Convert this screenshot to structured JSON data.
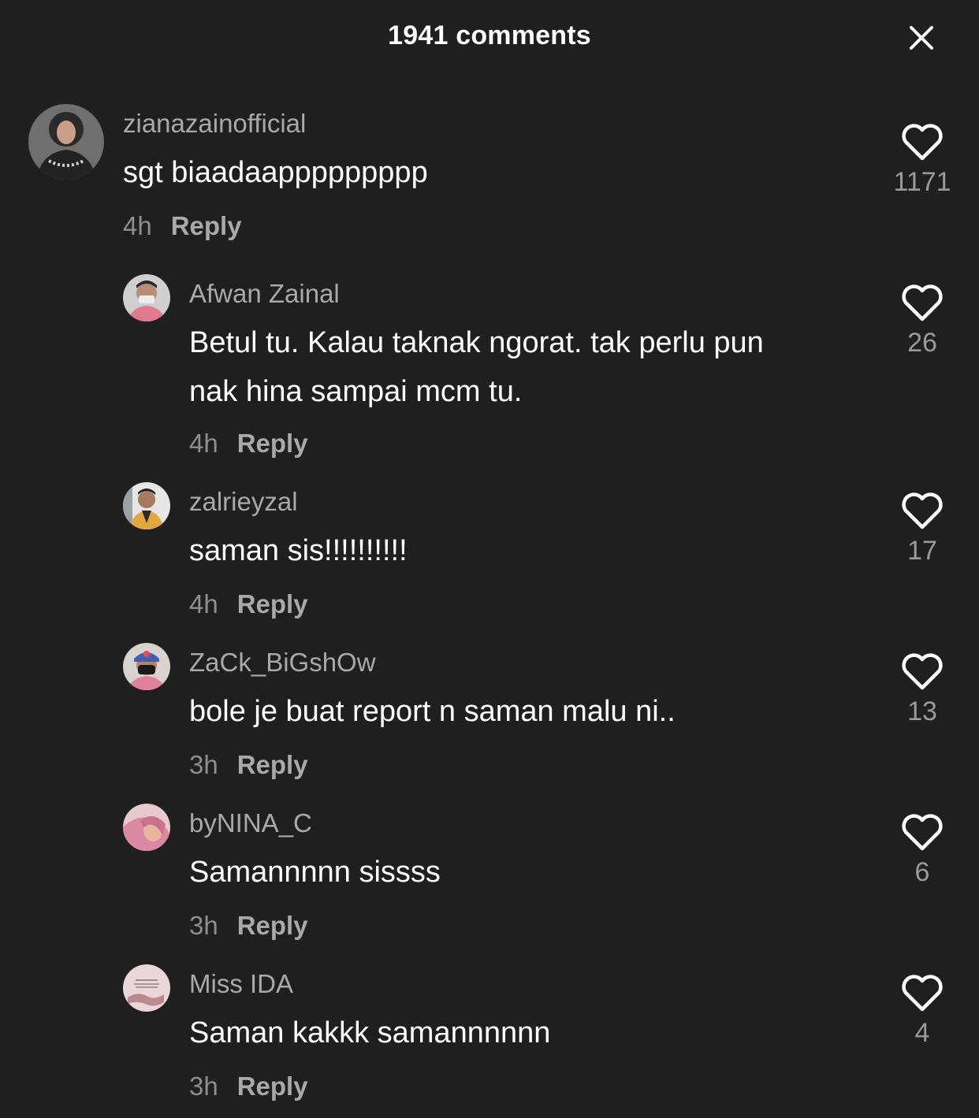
{
  "header": {
    "title": "1941 comments",
    "close_icon": "close-icon"
  },
  "colors": {
    "background": "#1f1f1f",
    "username": "#a9a9a9",
    "text": "#ffffff",
    "meta": "#8e8e8e"
  },
  "comments": [
    {
      "username": "zianazainofficial",
      "text": "sgt biaadaappppppppp",
      "time": "4h",
      "reply_label": "Reply",
      "likes": "1171",
      "like_icon": "heart-outline-icon"
    },
    {
      "username": "Afwan Zainal",
      "text": "Betul tu. Kalau taknak ngorat. tak perlu pun nak hina sampai mcm tu.",
      "time": "4h",
      "reply_label": "Reply",
      "likes": "26",
      "like_icon": "heart-outline-icon"
    },
    {
      "username": "zalrieyzal",
      "text": "saman sis!!!!!!!!!!",
      "time": "4h",
      "reply_label": "Reply",
      "likes": "17",
      "like_icon": "heart-outline-icon"
    },
    {
      "username": "ZaCk_BiGshOw",
      "text": "bole je buat report n saman malu ni..",
      "time": "3h",
      "reply_label": "Reply",
      "likes": "13",
      "like_icon": "heart-outline-icon"
    },
    {
      "username": "byNINA_C",
      "text": "Samannnnn sissss",
      "time": "3h",
      "reply_label": "Reply",
      "likes": "6",
      "like_icon": "heart-outline-icon"
    },
    {
      "username": "Miss IDA",
      "text": "Saman kakkk samannnnnn",
      "time": "3h",
      "reply_label": "Reply",
      "likes": "4",
      "like_icon": "heart-outline-icon"
    }
  ]
}
